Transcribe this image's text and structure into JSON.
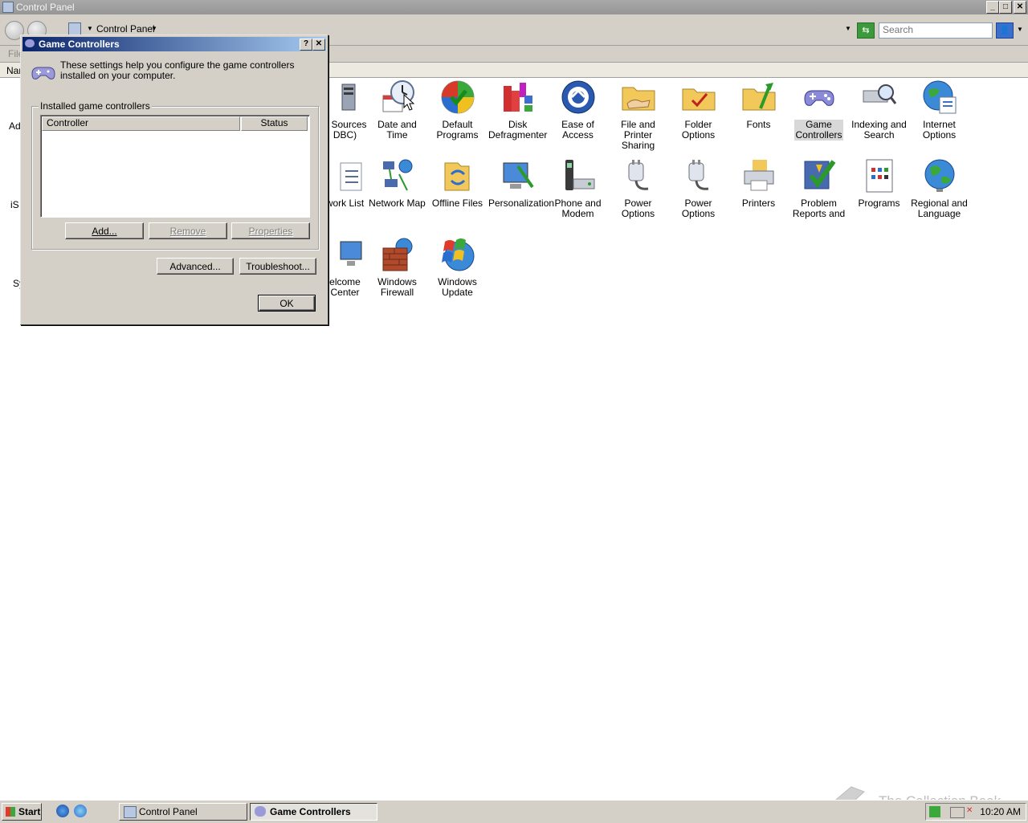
{
  "window": {
    "title": "Control Panel",
    "buttons": {
      "minimize": "_",
      "maximize": "□",
      "close": "✕"
    }
  },
  "address": {
    "crumb": "Control Panel",
    "search_placeholder": "Search"
  },
  "menubar": {
    "file_label": "File"
  },
  "header": {
    "name_col": "Name"
  },
  "left_partial": {
    "row1": "Ad",
    "row2": "iS",
    "row3": "Sy"
  },
  "items": [
    {
      "label": "Data Sources (ODBC)",
      "icon": "odbc-icon"
    },
    {
      "label": "Date and Time",
      "icon": "clock-calendar-icon"
    },
    {
      "label": "Default Programs",
      "icon": "default-programs-icon"
    },
    {
      "label": "Disk Defragmenter",
      "icon": "defrag-icon"
    },
    {
      "label": "Ease of Access",
      "icon": "ease-of-access-icon"
    },
    {
      "label": "File and Printer Sharing",
      "icon": "sharing-folder-icon"
    },
    {
      "label": "Folder Options",
      "icon": "folder-check-icon"
    },
    {
      "label": "Fonts",
      "icon": "fonts-folder-icon"
    },
    {
      "label": "Game Controllers",
      "icon": "gamepad-icon"
    },
    {
      "label": "Indexing and Search",
      "icon": "indexing-icon"
    },
    {
      "label": "Internet Options",
      "icon": "globe-icon"
    },
    {
      "label": "Network List",
      "icon": "network-list-icon"
    },
    {
      "label": "Network Map",
      "icon": "network-map-icon"
    },
    {
      "label": "Offline Files",
      "icon": "offline-files-icon"
    },
    {
      "label": "Personalization",
      "icon": "personalization-icon"
    },
    {
      "label": "Phone and Modem",
      "icon": "phone-modem-icon"
    },
    {
      "label": "Power Options",
      "icon": "power-plug-icon"
    },
    {
      "label": "Power Options",
      "icon": "power-plug-icon"
    },
    {
      "label": "Printers",
      "icon": "printer-icon"
    },
    {
      "label": "Problem Reports and",
      "icon": "problem-reports-icon"
    },
    {
      "label": "Programs",
      "icon": "programs-icon"
    },
    {
      "label": "Regional and Language",
      "icon": "regional-globe-icon"
    },
    {
      "label": "Welcome Center",
      "icon": "welcome-center-icon"
    },
    {
      "label": "Windows Firewall",
      "icon": "firewall-icon"
    },
    {
      "label": "Windows Update",
      "icon": "windows-update-icon"
    }
  ],
  "item_lines": {
    "odbc": [
      "a Sources",
      "DBC)"
    ],
    "date_time": [
      "Date and Time"
    ],
    "default_programs": [
      "Default",
      "Programs"
    ],
    "disk_defrag": [
      "Disk",
      "Defragmenter"
    ],
    "ease": [
      "Ease of",
      "Access"
    ],
    "file_printer": [
      "File and Printer",
      "Sharing"
    ],
    "folder_options": [
      "Folder Options"
    ],
    "fonts": [
      "Fonts"
    ],
    "game_controllers": [
      "Game",
      "Controllers"
    ],
    "indexing": [
      "Indexing and",
      "Search"
    ],
    "internet": [
      "Internet",
      "Options"
    ],
    "network_list": [
      "work List"
    ],
    "network_map": [
      "Network Map"
    ],
    "offline_files": [
      "Offline Files"
    ],
    "personalization": [
      "Personalization"
    ],
    "phone_modem": [
      "Phone and",
      "Modem"
    ],
    "power1": [
      "Power Options"
    ],
    "power2": [
      "Power Options"
    ],
    "printers": [
      "Printers"
    ],
    "problem_reports": [
      "Problem",
      "Reports and"
    ],
    "programs": [
      "Programs"
    ],
    "regional": [
      "Regional and",
      "Language"
    ],
    "welcome": [
      "elcome",
      "Center"
    ],
    "firewall": [
      "Windows",
      "Firewall"
    ],
    "update": [
      "Windows",
      "Update"
    ]
  },
  "dialog": {
    "title": "Game Controllers",
    "help_btn": "?",
    "close_btn": "✕",
    "description": "These settings help you configure the game controllers installed on your computer.",
    "group_label": "Installed game controllers",
    "columns": [
      "Controller",
      "Status"
    ],
    "buttons": {
      "add": "Add...",
      "remove": "Remove",
      "properties": "Properties",
      "advanced": "Advanced...",
      "troubleshoot": "Troubleshoot...",
      "ok": "OK"
    }
  },
  "taskbar": {
    "start": "Start",
    "tasks": [
      "Control Panel",
      "Game Controllers"
    ],
    "clock": "10:20 AM"
  },
  "watermark": "The Collection Book"
}
